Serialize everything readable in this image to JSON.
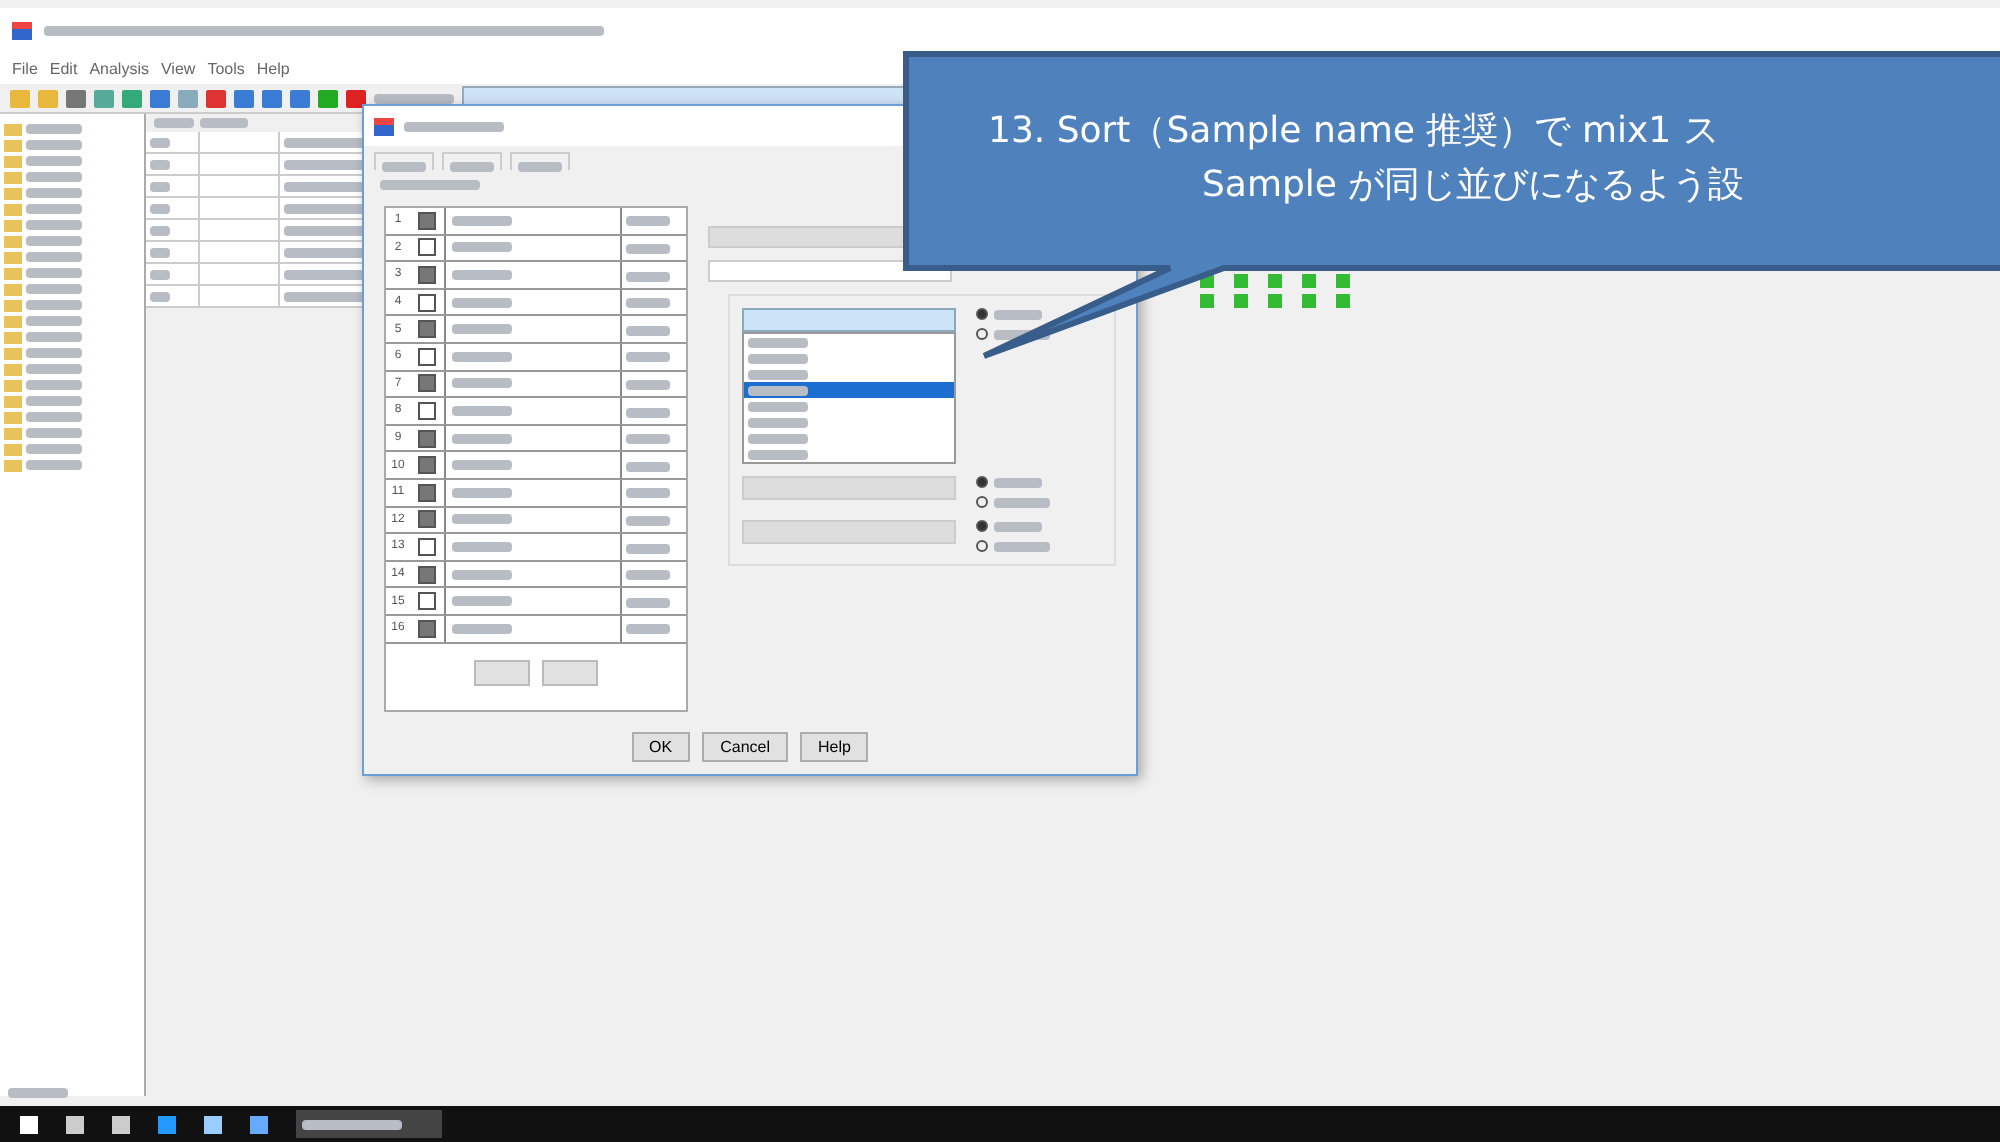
{
  "menu": [
    "File",
    "Edit",
    "Analysis",
    "View",
    "Tools",
    "Help"
  ],
  "dialog": {
    "rows": [
      {
        "number": "1",
        "checked": true
      },
      {
        "number": "2",
        "checked": false
      },
      {
        "number": "3",
        "checked": true
      },
      {
        "number": "4",
        "checked": false
      },
      {
        "number": "5",
        "checked": true
      },
      {
        "number": "6",
        "checked": false
      },
      {
        "number": "7",
        "checked": true
      },
      {
        "number": "8",
        "checked": false
      },
      {
        "number": "9",
        "checked": true
      },
      {
        "number": "10",
        "checked": true
      },
      {
        "number": "11",
        "checked": true
      },
      {
        "number": "12",
        "checked": true
      },
      {
        "number": "13",
        "checked": false
      },
      {
        "number": "14",
        "checked": true
      },
      {
        "number": "15",
        "checked": false
      },
      {
        "number": "16",
        "checked": true
      }
    ],
    "sort_list": [
      {
        "selected": false
      },
      {
        "selected": false
      },
      {
        "selected": false
      },
      {
        "selected": true
      },
      {
        "selected": false
      },
      {
        "selected": false
      },
      {
        "selected": false
      },
      {
        "selected": false
      }
    ],
    "sort_groups": [
      {
        "ascending": true
      },
      {
        "ascending": true
      },
      {
        "ascending": true
      }
    ],
    "buttons": [
      "OK",
      "Cancel",
      "Help"
    ]
  },
  "callout": {
    "lines": [
      "13. Sort（Sample name 推奨）で mix1 ス",
      "Sample が同じ並びになるよう設"
    ]
  }
}
